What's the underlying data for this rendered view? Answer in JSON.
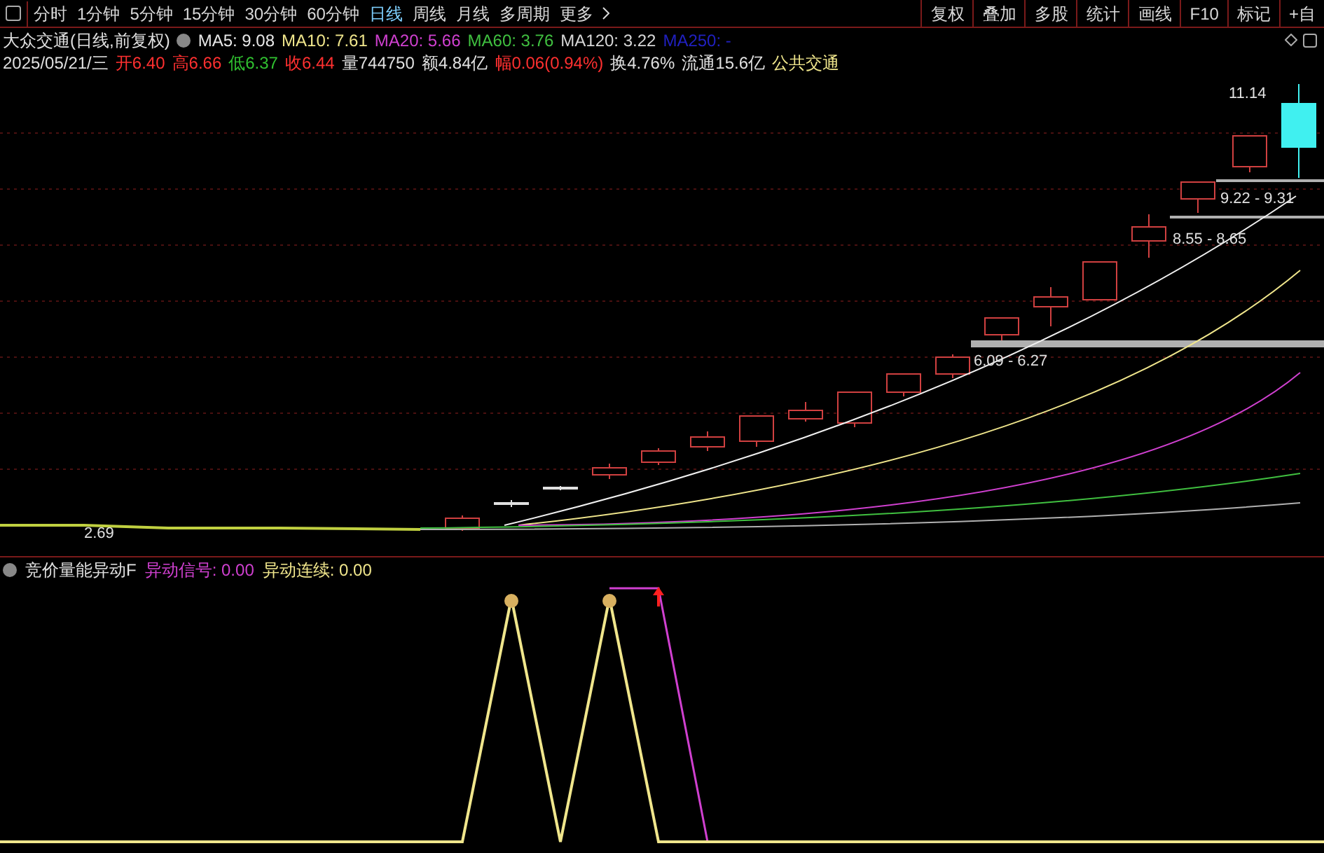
{
  "period_tabs": [
    {
      "label": "分时",
      "selected": false
    },
    {
      "label": "1分钟",
      "selected": false
    },
    {
      "label": "5分钟",
      "selected": false
    },
    {
      "label": "15分钟",
      "selected": false
    },
    {
      "label": "30分钟",
      "selected": false
    },
    {
      "label": "60分钟",
      "selected": false
    },
    {
      "label": "日线",
      "selected": true
    },
    {
      "label": "周线",
      "selected": false
    },
    {
      "label": "月线",
      "selected": false
    },
    {
      "label": "多周期",
      "selected": false
    },
    {
      "label": "更多",
      "selected": false
    }
  ],
  "toolbar_buttons": [
    "复权",
    "叠加",
    "多股",
    "统计",
    "画线",
    "F10",
    "标记",
    "+自"
  ],
  "title": "大众交通(日线,前复权)",
  "moving_averages": [
    {
      "label": "MA5: 9.08",
      "color": "#e8e8e8"
    },
    {
      "label": "MA10: 7.61",
      "color": "#f0e68c"
    },
    {
      "label": "MA20: 5.66",
      "color": "#d040d0"
    },
    {
      "label": "MA60: 3.76",
      "color": "#40c040"
    },
    {
      "label": "MA120: 3.22",
      "color": "#d8d8d8"
    },
    {
      "label": "MA250: -",
      "color": "#2020c0"
    }
  ],
  "date": "2025/05/21/三",
  "quote_fields": [
    {
      "label": "开",
      "value": "6.40",
      "color": "#ff3030"
    },
    {
      "label": "高",
      "value": "6.66",
      "color": "#ff3030"
    },
    {
      "label": "低",
      "value": "6.37",
      "color": "#30c030"
    },
    {
      "label": "收",
      "value": "6.44",
      "color": "#ff3030"
    },
    {
      "label": "量",
      "value": "744750",
      "color": "#e0e0e0"
    },
    {
      "label": "额",
      "value": "4.84亿",
      "color": "#e0e0e0"
    },
    {
      "label": "幅",
      "value": "0.06(0.94%)",
      "color": "#ff3030"
    },
    {
      "label": "换",
      "value": "4.76%",
      "color": "#e0e0e0"
    },
    {
      "label": "流通",
      "value": "15.6亿",
      "color": "#e0e0e0"
    }
  ],
  "sector": "公共交通",
  "price_labels": {
    "high": "11.14",
    "zone_top": "9.22 - 9.31",
    "zone_mid": "8.55 - 8.65",
    "zone_low": "6.09 - 6.27",
    "low": "2.69"
  },
  "indicator": {
    "name": "竞价量能异动F",
    "outputs": [
      {
        "label": "异动信号: 0.00",
        "color": "#d040d0"
      },
      {
        "label": "异动连续: 0.00",
        "color": "#f0e68c"
      }
    ]
  }
}
